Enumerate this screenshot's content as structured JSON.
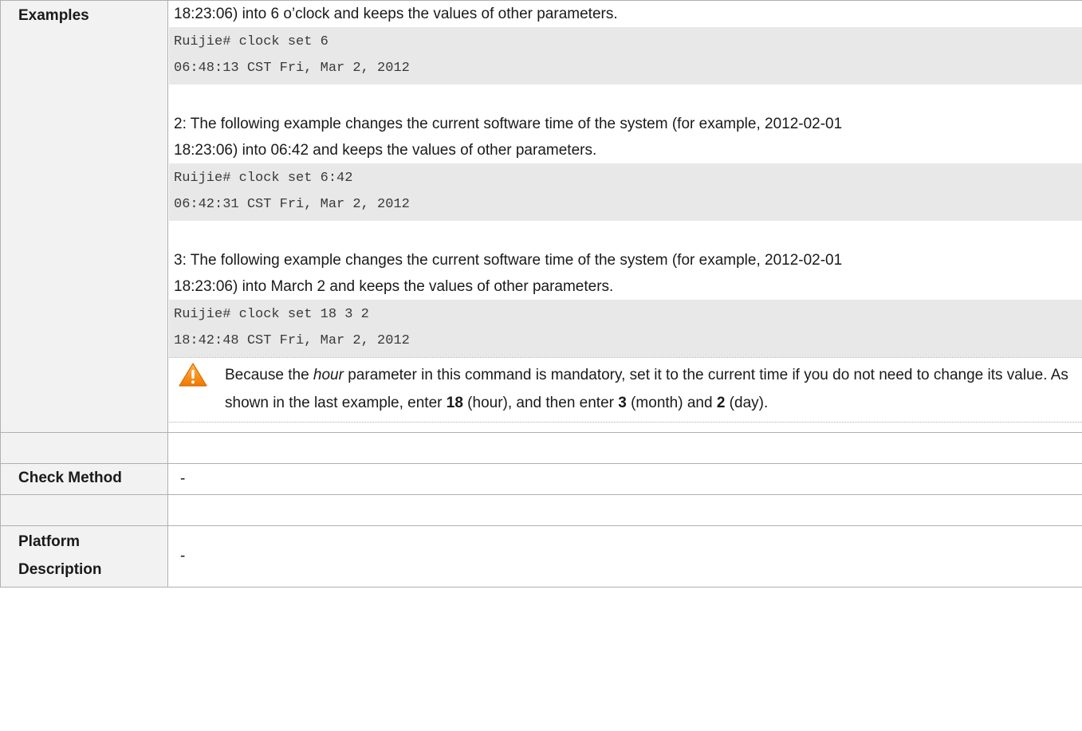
{
  "examples": {
    "label": "Examples",
    "intro_line": "18:23:06) into 6 o’clock and keeps the values of other parameters.",
    "code1": [
      "Ruijie# clock set 6",
      "06:48:13 CST Fri, Mar 2, 2012"
    ],
    "ex2_line1": "2: The following example changes the current software time of the system (for example, 2012-02-01",
    "ex2_line2": "18:23:06) into 06:42 and keeps the values of other parameters.",
    "code2": [
      "Ruijie# clock set 6:42",
      "06:42:31 CST Fri, Mar 2, 2012"
    ],
    "ex3_line1": "3: The following example changes the current software time of the system (for example, 2012-02-01",
    "ex3_line2": "18:23:06) into March 2 and keeps the values of other parameters.",
    "code3": [
      "Ruijie# clock set 18 3 2",
      "18:42:48 CST Fri, Mar 2, 2012"
    ],
    "note": {
      "icon": "warning-icon",
      "t1": "Because the ",
      "t2": "hour",
      "t3": " parameter in this command is mandatory, set it to the current time if you do not need to change its value. As shown in the last example, enter ",
      "b1": "18",
      "t4": " (hour), and then enter ",
      "b2": "3",
      "t5": " (month) and ",
      "b3": "2",
      "t6": " (day)."
    }
  },
  "check_method": {
    "label": "Check Method",
    "value": "-"
  },
  "platform": {
    "label_line1": "Platform",
    "label_line2": "Description",
    "value": "-"
  }
}
